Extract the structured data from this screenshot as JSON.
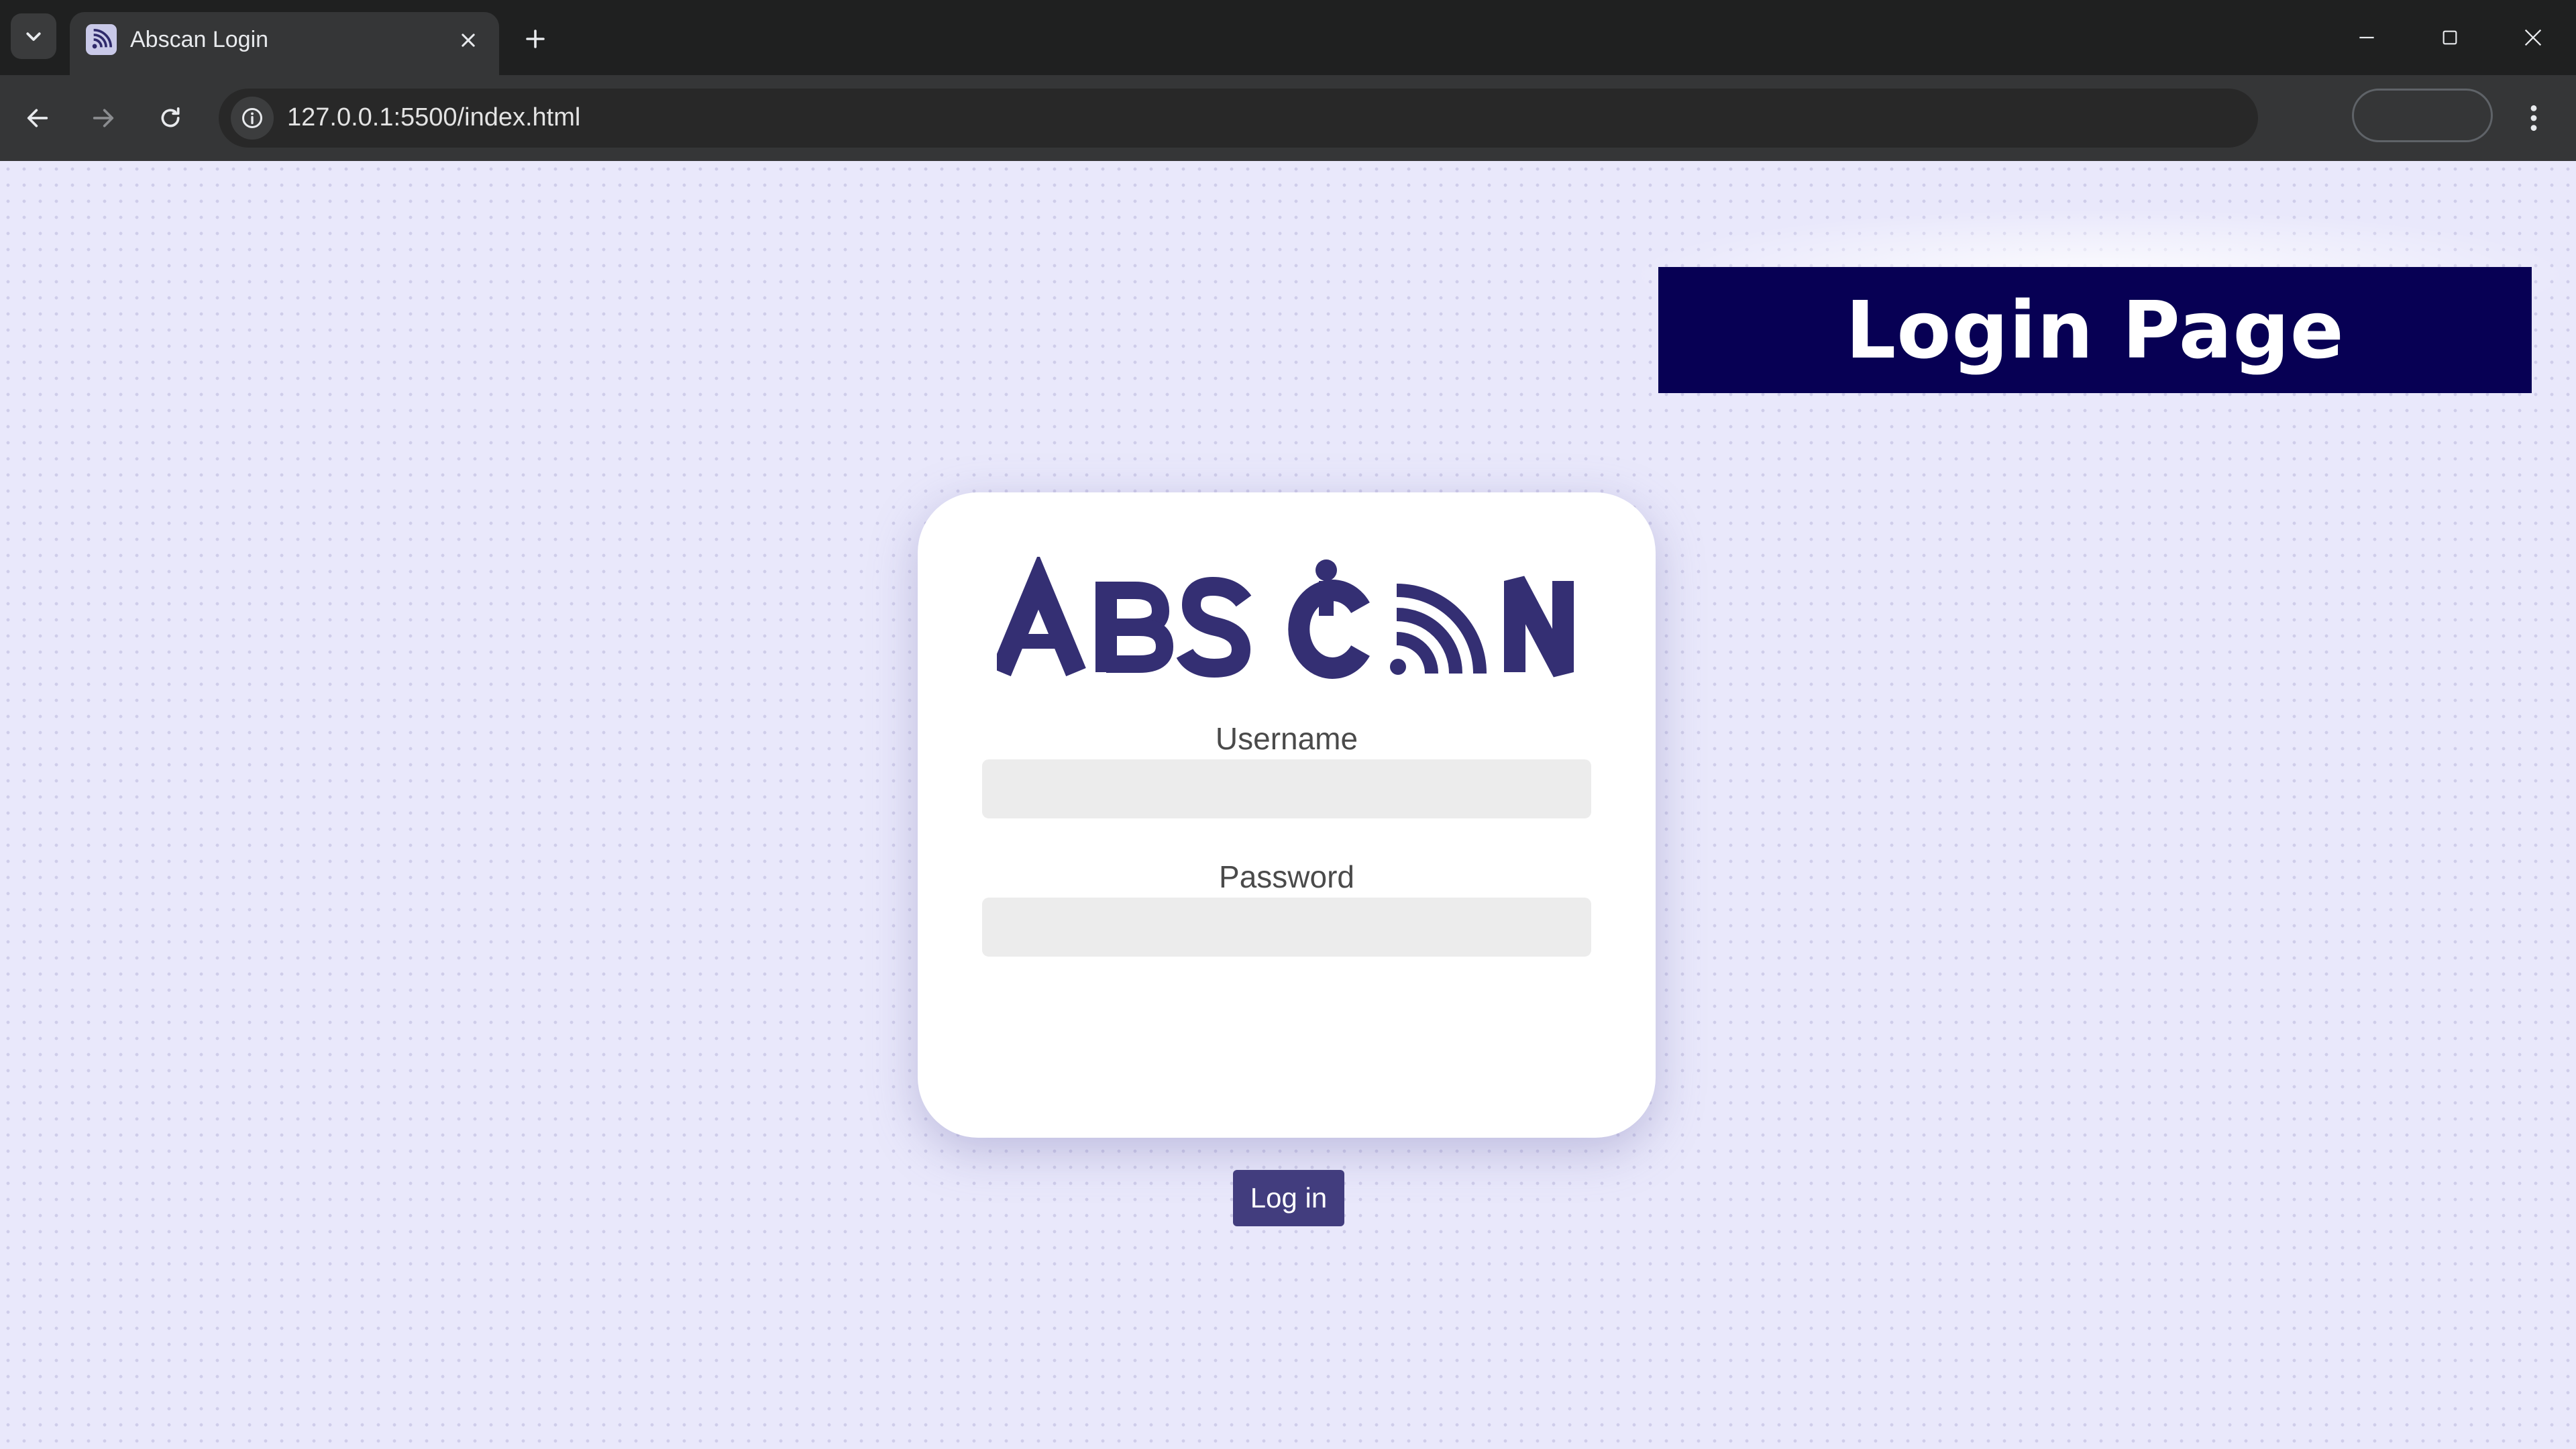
{
  "browser": {
    "tab": {
      "title": "Abscan Login",
      "favicon": "rss-wifi-icon"
    },
    "url": "127.0.0.1:5500/index.html",
    "icons": {
      "tab_search": "chevron-down-icon",
      "tab_close": "close-icon",
      "new_tab": "plus-icon",
      "back": "arrow-left-icon",
      "forward": "arrow-right-icon",
      "reload": "reload-icon",
      "site_info": "info-icon",
      "menu": "kebab-menu-icon",
      "minimize": "minimize-icon",
      "maximize": "maximize-icon",
      "close_window": "close-icon"
    }
  },
  "banner": {
    "text": "Login Page"
  },
  "login": {
    "logo_text": "ABSCAN",
    "username_label": "Username",
    "username_value": "",
    "password_label": "Password",
    "password_value": "",
    "submit_label": "Log in"
  },
  "colors": {
    "page_background": "#e9e8fb",
    "brand": "#342f73",
    "banner_background": "#070054",
    "button": "#423d7e"
  }
}
